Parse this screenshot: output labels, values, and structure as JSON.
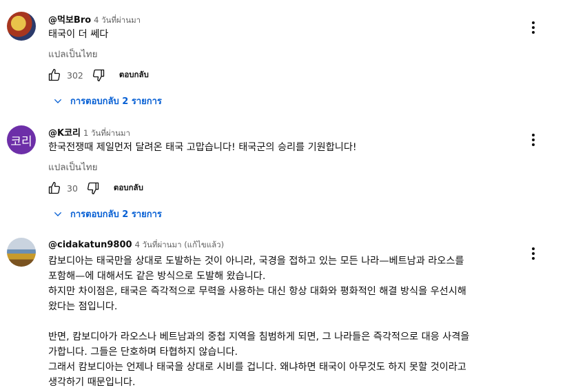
{
  "comments": [
    {
      "author": "@먹보Bro",
      "time": "4 วันที่ผ่านมา",
      "text": "태국이 더 쎄다",
      "translate": "แปลเป็นไทย",
      "likes": "302",
      "reply": "ตอบกลับ",
      "replies": "การตอบกลับ 2 รายการ"
    },
    {
      "author": "@K코리",
      "avatar_text": "코리",
      "time": "1 วันที่ผ่านมา",
      "text": "한국전쟁때 제일먼저 달려온 태국 고맙습니다! 태국군의 승리를 기원합니다!",
      "translate": "แปลเป็นไทย",
      "likes": "30",
      "reply": "ตอบกลับ",
      "replies": "การตอบกลับ 2 รายการ"
    },
    {
      "author": "@cidakatun9800",
      "time": "4 วันที่ผ่านมา (แก้ไขแล้ว)",
      "text": "캄보디아는 태국만을 상대로 도발하는 것이 아니라, 국경을 접하고 있는 모든 나라—베트남과 라오스를\n포함해—에 대해서도 같은 방식으로 도발해 왔습니다.\n하지만 차이점은, 태국은 즉각적으로 무력을 사용하는 대신 항상 대화와 평화적인 해결 방식을 우선시해\n왔다는 점입니다.\n\n반면, 캄보디아가 라오스나 베트남과의 중첩 지역을 침범하게 되면, 그 나라들은 즉각적으로 대응 사격을\n가합니다. 그들은 단호하며 타협하지 않습니다.\n그래서 캄보디아는 언제나 태국을 상대로 시비를 겁니다. 왜냐하면 태국이 아무것도 하지 못할 것이라고\n생각하기 때문입니다."
    }
  ],
  "icons": [
    "thumb-up-icon",
    "thumb-down-icon",
    "chevron-down-icon",
    "more-vert-icon"
  ],
  "colors": {
    "link": "#065fd4",
    "secondary": "#606060",
    "text": "#0f0f0f"
  }
}
